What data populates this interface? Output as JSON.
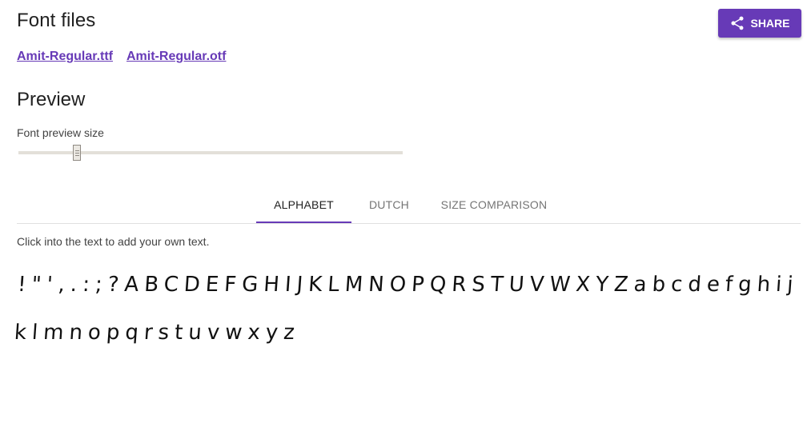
{
  "font_files": {
    "title": "Font files",
    "files": [
      {
        "label": "Amit-Regular.ttf"
      },
      {
        "label": "Amit-Regular.otf"
      }
    ]
  },
  "share_button": {
    "label": "SHARE",
    "icon": "share-icon"
  },
  "preview": {
    "title": "Preview",
    "slider_label": "Font preview size",
    "slider_value_fraction": 0.153
  },
  "tabs": [
    {
      "label": "ALPHABET",
      "active": true
    },
    {
      "label": "DUTCH",
      "active": false
    },
    {
      "label": "SIZE COMPARISON",
      "active": false
    }
  ],
  "hint": "Click into the text to add your own text.",
  "sample_text": "!\"',.:;?ABCDEFGHIJKLMNOPQRSTUVWXYZabcdefghijklmnopqrstuvwxyz",
  "colors": {
    "accent": "#673ab7"
  }
}
